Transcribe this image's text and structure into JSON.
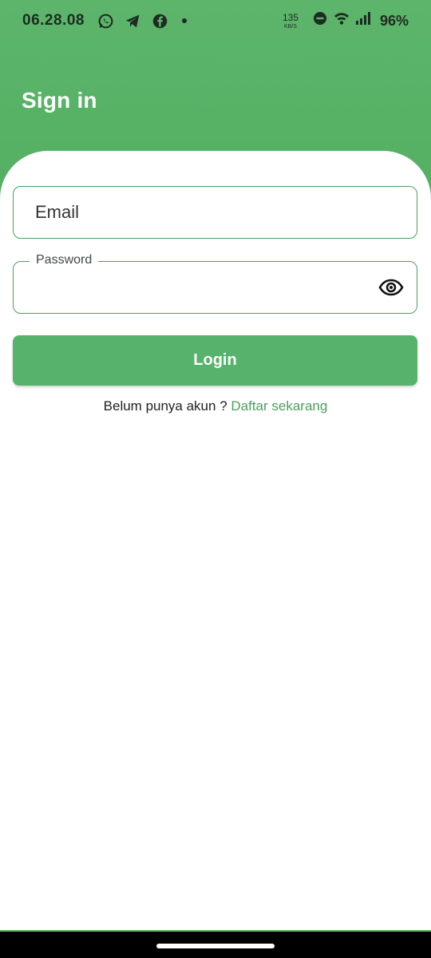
{
  "status_bar": {
    "time": "06.28.08",
    "net_speed": "135",
    "net_unit": "KB/S",
    "battery": "96%",
    "app_icons": [
      "whatsapp-icon",
      "telegram-icon",
      "facebook-icon"
    ]
  },
  "page": {
    "title": "Sign in"
  },
  "form": {
    "email_placeholder": "Email",
    "password_label": "Password",
    "login_label": "Login",
    "signup_prompt": "Belum punya akun ? ",
    "signup_link": "Daftar sekarang"
  },
  "colors": {
    "primary": "#57b26b",
    "link": "#4d9e5a",
    "border": "#4f9f5c"
  }
}
